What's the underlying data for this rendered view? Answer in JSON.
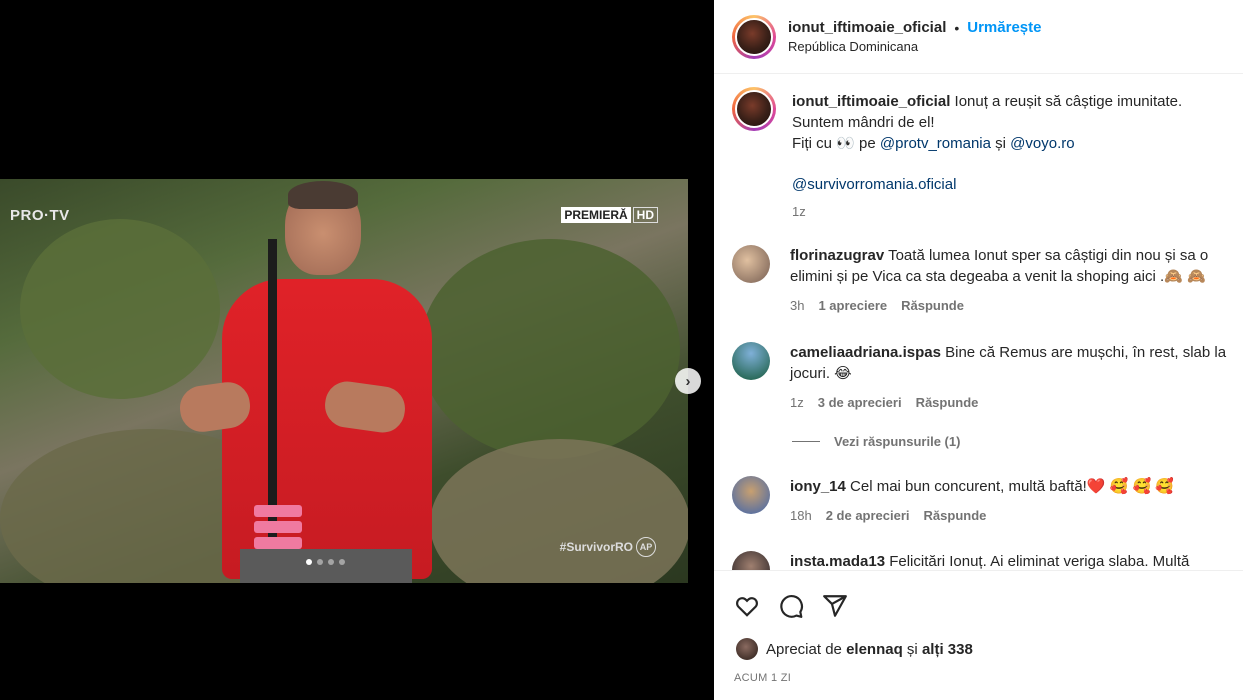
{
  "post": {
    "username": "ionut_iftimoaie_oficial",
    "separator": "•",
    "follow_label": "Urmărește",
    "location": "República Dominicana"
  },
  "media": {
    "channel_logo": "PRO·TV",
    "badge_premiera": "PREMIERĂ",
    "badge_hd": "HD",
    "hashtag": "#SurvivorRO",
    "ap_badge": "AP",
    "next_icon": "chevron-right-icon",
    "slides": 4,
    "active_slide": 1
  },
  "caption": {
    "username": "ionut_iftimoaie_oficial",
    "line1": "Ionuț a reușit să câștige imunitate.",
    "line2": "Suntem mândri de el!",
    "line3_prefix": "Fiți cu 👀 pe ",
    "mention1": "@protv_romania",
    "line3_and": " și ",
    "mention2": "@voyo.ro",
    "mention3": "@survivorromania.oficial",
    "time": "1z"
  },
  "comments": [
    {
      "username": "florinazugrav",
      "text": "Toată lumea Ionut sper sa câștigi din nou și sa o elimini și pe Vica ca sta degeaba a venit la shoping aici .🙈 🙈",
      "time": "3h",
      "likes": "1 apreciere",
      "reply": "Răspunde"
    },
    {
      "username": "cameliaadriana.ispas",
      "text": "Bine că Remus are mușchi, în rest, slab la jocuri. 😂",
      "time": "1z",
      "likes": "3 de aprecieri",
      "reply": "Răspunde"
    },
    {
      "username": "iony_14",
      "text": "Cel mai bun concurent, multă baftă!❤️ 🥰 🥰 🥰",
      "time": "18h",
      "likes": "2 de aprecieri",
      "reply": "Răspunde"
    },
    {
      "username": "insta.mada13",
      "text": "Felicitări Ionuț. Ai eliminat veriga slaba. Multă"
    }
  ],
  "view_replies": "Vezi răspunsurile (1)",
  "actions": {
    "like_icon": "heart-icon",
    "comment_icon": "comment-icon",
    "share_icon": "share-icon"
  },
  "likes": {
    "prefix": "Apreciat de ",
    "user": "elennaq",
    "middle": " și ",
    "others": "alți 338"
  },
  "posted": "ACUM 1 ZI",
  "colors": {
    "accent": "#0095f6",
    "mention": "#00376b",
    "muted": "#737373"
  }
}
